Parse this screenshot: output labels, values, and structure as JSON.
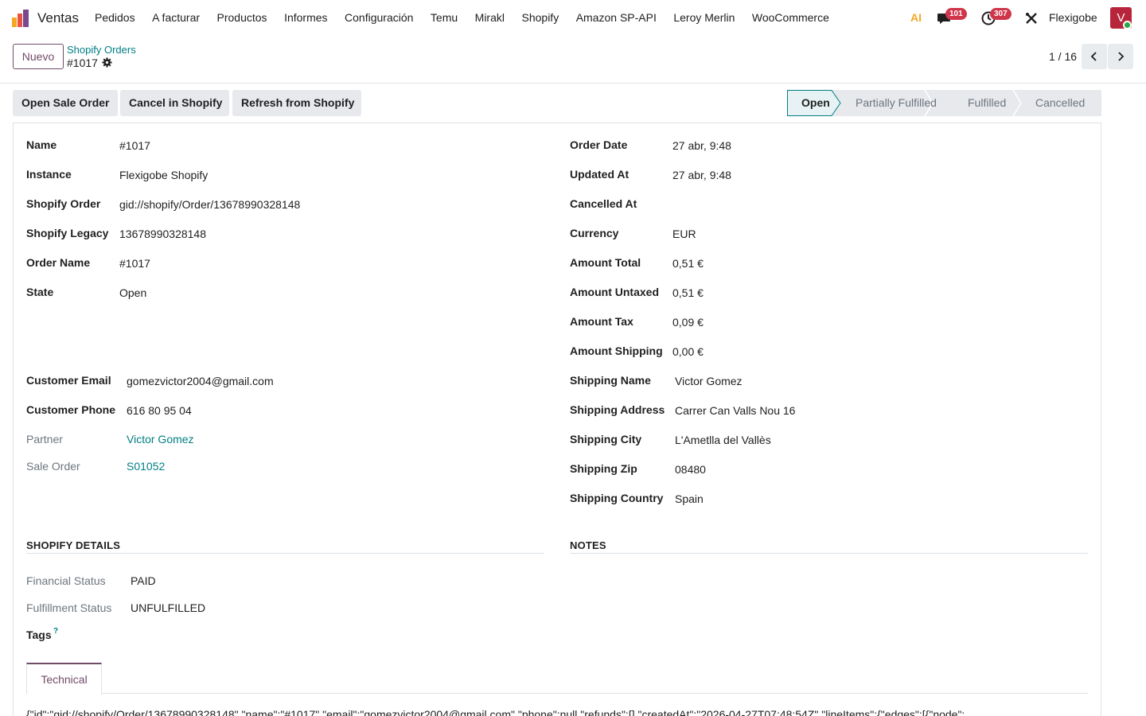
{
  "navbar": {
    "app_name": "Ventas",
    "menu": [
      "Pedidos",
      "A facturar",
      "Productos",
      "Informes",
      "Configuración",
      "Temu",
      "Mirakl",
      "Shopify",
      "Amazon SP-API",
      "Leroy Merlin",
      "WooCommerce"
    ],
    "ai_label": "AI",
    "messages_count": "101",
    "activities_count": "307",
    "company": "Flexigobe",
    "avatar_initial": "V"
  },
  "control": {
    "new_label": "Nuevo",
    "breadcrumb_parent": "Shopify Orders",
    "breadcrumb_current": "#1017",
    "pager": "1 / 16"
  },
  "actions": [
    "Open Sale Order",
    "Cancel in Shopify",
    "Refresh from Shopify"
  ],
  "status": {
    "stages": [
      "Open",
      "Partially Fulfilled",
      "Fulfilled",
      "Cancelled"
    ],
    "active": "Open"
  },
  "left_fields": [
    {
      "label": "Name",
      "value": "#1017"
    },
    {
      "label": "Instance",
      "value": "Flexigobe Shopify"
    },
    {
      "label": "Shopify Order",
      "value": "gid://shopify/Order/13678990328148"
    },
    {
      "label": "Shopify Legacy",
      "value": "13678990328148"
    },
    {
      "label": "Order Name",
      "value": "#1017"
    },
    {
      "label": "State",
      "value": "Open"
    }
  ],
  "customer_fields": [
    {
      "label": "Customer Email",
      "value": "gomezvictor2004@gmail.com"
    },
    {
      "label": "Customer Phone",
      "value": "616 80 95 04"
    }
  ],
  "link_fields": [
    {
      "label": "Partner",
      "value": "Victor Gomez"
    },
    {
      "label": "Sale Order",
      "value": "S01052"
    }
  ],
  "right_fields": [
    {
      "label": "Order Date",
      "value": "27 abr, 9:48"
    },
    {
      "label": "Updated At",
      "value": "27 abr, 9:48"
    },
    {
      "label": "Cancelled At",
      "value": ""
    },
    {
      "label": "Currency",
      "value": "EUR"
    },
    {
      "label": "Amount Total",
      "value": "0,51 €"
    },
    {
      "label": "Amount Untaxed",
      "value": "0,51 €"
    },
    {
      "label": "Amount Tax",
      "value": "0,09 €"
    },
    {
      "label": "Amount Shipping",
      "value": "0,00 €"
    }
  ],
  "shipping_fields": [
    {
      "label": "Shipping Name",
      "value": "Victor Gomez"
    },
    {
      "label": "Shipping Address",
      "value": "Carrer Can Valls Nou 16"
    },
    {
      "label": "Shipping City",
      "value": "L'Ametlla del Vallès"
    },
    {
      "label": "Shipping Zip",
      "value": "08480"
    },
    {
      "label": "Shipping Country",
      "value": "Spain"
    }
  ],
  "shopify_details": {
    "title": "SHOPIFY DETAILS",
    "financial_label": "Financial Status",
    "financial_value": "PAID",
    "fulfillment_label": "Fulfillment Status",
    "fulfillment_value": "UNFULFILLED",
    "tags_label": "Tags",
    "tags_help": "?"
  },
  "notes": {
    "title": "NOTES"
  },
  "tabs": {
    "technical": "Technical",
    "json_preview": "{\"id\":\"gid://shopify/Order/13678990328148\",\"name\":\"#1017\",\"email\":\"gomezvictor2004@gmail.com\",\"phone\":null,\"refunds\":[],\"createdAt\":\"2026-04-27T07:48:54Z\",\"lineItems\":{\"edges\":[{\"node\":"
  },
  "colors": {
    "brand": "#714b67",
    "link": "#017e84",
    "badge": "#d0364b"
  }
}
